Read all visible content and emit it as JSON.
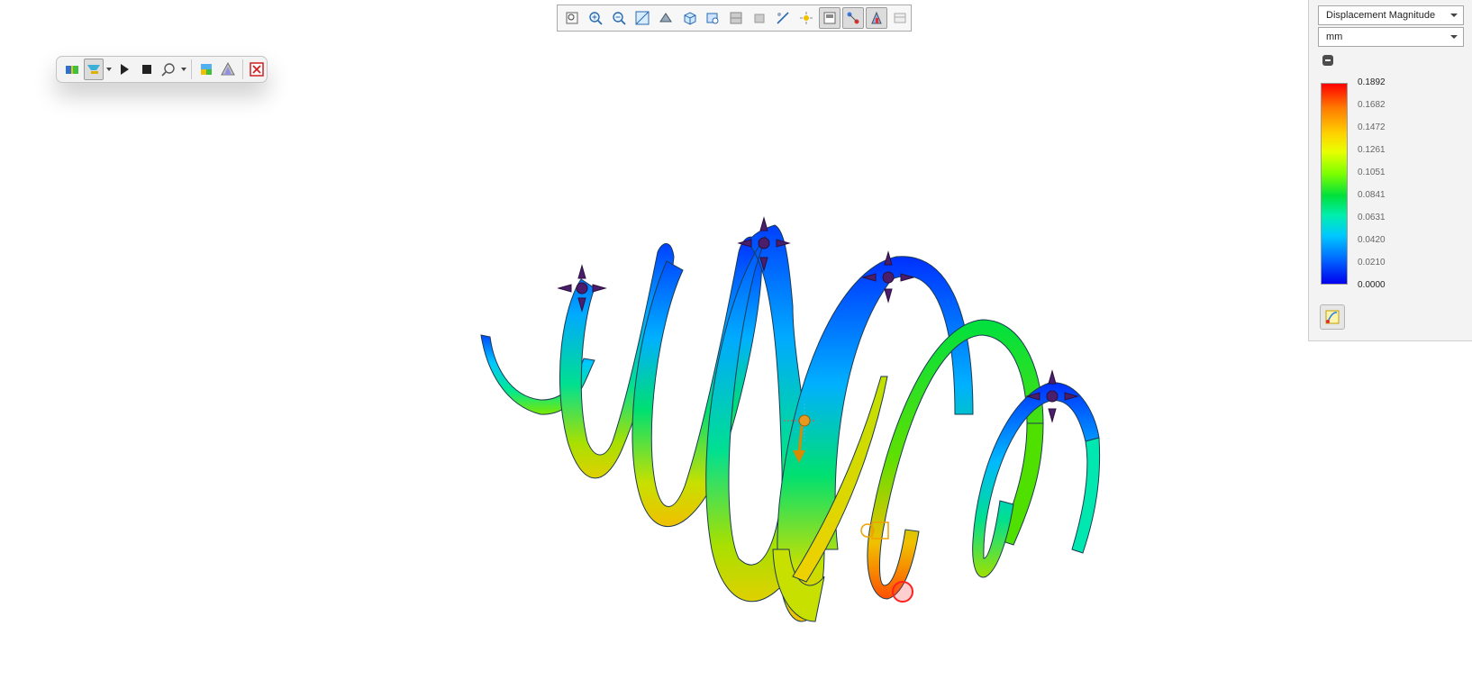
{
  "top_toolbar": {
    "buttons": [
      {
        "name": "zoom-to-fit-icon",
        "active": false
      },
      {
        "name": "zoom-in-icon",
        "active": false
      },
      {
        "name": "zoom-out-icon",
        "active": false
      },
      {
        "name": "zoom-to-area-icon",
        "active": false
      },
      {
        "name": "orient-view-icon",
        "active": false
      },
      {
        "name": "cube-view-icon",
        "active": false
      },
      {
        "name": "display-style-icon",
        "active": false
      },
      {
        "name": "section-view-icon",
        "active": false
      },
      {
        "name": "hide-show-icon",
        "active": false
      },
      {
        "name": "edit-appearance-icon",
        "active": false
      },
      {
        "name": "scene-lights-icon",
        "active": false
      },
      {
        "name": "view-settings-icon",
        "active": true
      },
      {
        "name": "connectors-icon",
        "active": true
      },
      {
        "name": "deformed-result-icon",
        "active": true
      },
      {
        "name": "more-views-icon",
        "active": false
      }
    ]
  },
  "anim_toolbar": {
    "buttons": [
      "plot-icon",
      "display-icon",
      "play-icon",
      "stop-icon",
      "probe-icon",
      "chart-options-icon",
      "deformation-icon",
      "close-icon"
    ]
  },
  "legend": {
    "result_type": "Displacement Magnitude",
    "unit": "mm",
    "ticks": [
      "0.1892",
      "0.1682",
      "0.1472",
      "0.1261",
      "0.1051",
      "0.0841",
      "0.0631",
      "0.0420",
      "0.0210",
      "0.0000"
    ],
    "max_color": "#ff0000",
    "min_color": "#0000ee"
  },
  "model": {
    "description_icon": "helical-spring-result-plot"
  }
}
